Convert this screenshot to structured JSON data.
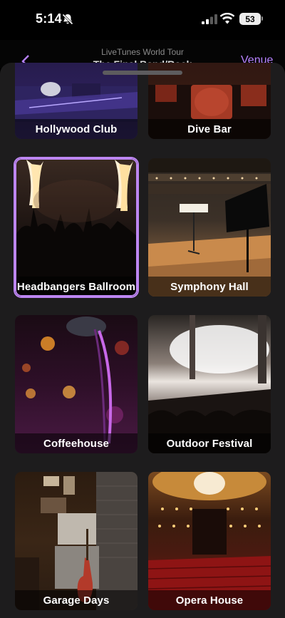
{
  "status_bar": {
    "time": "5:14",
    "battery": "53"
  },
  "background_screen": {
    "subtitle": "LiveTunes World Tour",
    "title": "The Final Band/Rock",
    "action": "Venue"
  },
  "venues": [
    {
      "label": "Hollywood Club",
      "selected": false
    },
    {
      "label": "Dive Bar",
      "selected": false
    },
    {
      "label": "Headbangers Ballroom",
      "selected": true
    },
    {
      "label": "Symphony Hall",
      "selected": false
    },
    {
      "label": "Coffeehouse",
      "selected": false
    },
    {
      "label": "Outdoor Festival",
      "selected": false
    },
    {
      "label": "Garage Days",
      "selected": false
    },
    {
      "label": "Opera House",
      "selected": false
    }
  ],
  "colors": {
    "accent": "#bd86f2",
    "sheet_background": "#1d1c1d"
  }
}
